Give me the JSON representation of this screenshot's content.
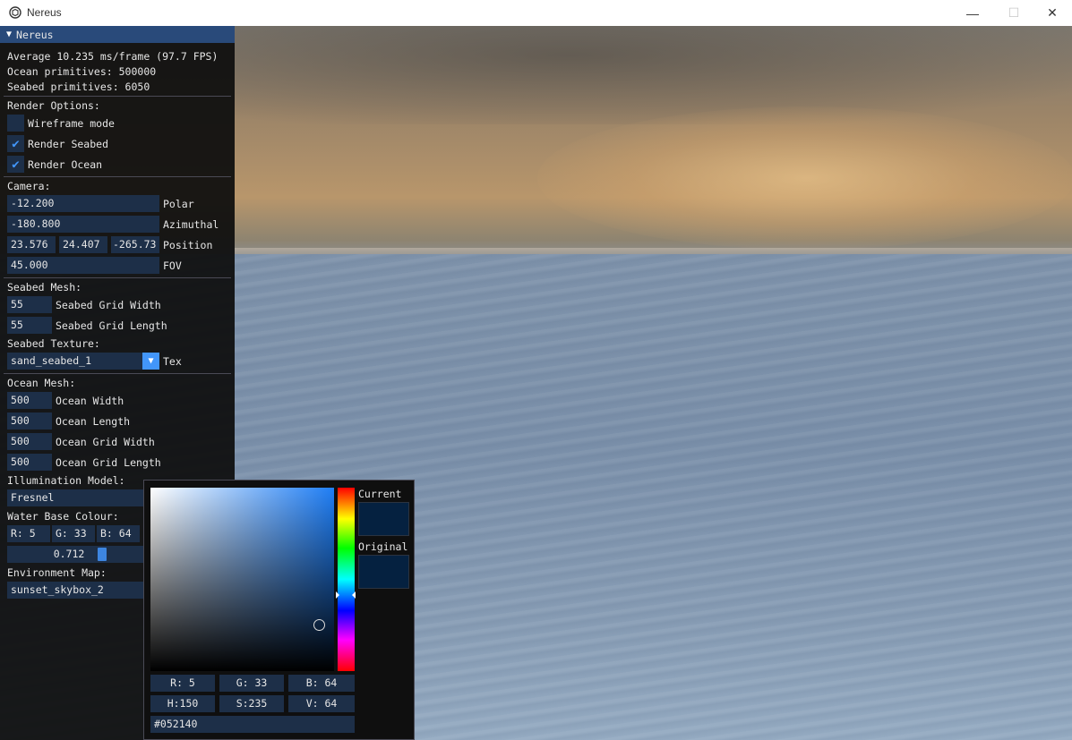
{
  "window": {
    "title": "Nereus",
    "minimize_glyph": "—",
    "maximize_glyph": "☐",
    "close_glyph": "✕"
  },
  "panel": {
    "title": "Nereus",
    "stats": {
      "frame_time": "Average 10.235 ms/frame (97.7 FPS)",
      "ocean_primitives": "Ocean primitives: 500000",
      "seabed_primitives": "Seabed primitives: 6050"
    },
    "render_options": {
      "heading": "Render Options:",
      "wireframe_label": "Wireframe mode",
      "wireframe_checked": false,
      "render_seabed_label": "Render Seabed",
      "render_seabed_checked": true,
      "render_ocean_label": "Render Ocean",
      "render_ocean_checked": true
    },
    "camera": {
      "heading": "Camera:",
      "polar_value": "-12.200",
      "polar_label": "Polar",
      "azimuthal_value": "-180.800",
      "azimuthal_label": "Azimuthal",
      "position_x": "23.576",
      "position_y": "24.407",
      "position_z": "-265.73",
      "position_label": "Position",
      "fov_value": "45.000",
      "fov_label": "FOV"
    },
    "seabed_mesh": {
      "heading": "Seabed Mesh:",
      "grid_width_value": "55",
      "grid_width_label": "Seabed Grid Width",
      "grid_length_value": "55",
      "grid_length_label": "Seabed Grid Length"
    },
    "seabed_texture": {
      "heading": "Seabed Texture:",
      "selected": "sand_seabed_1",
      "label": "Tex"
    },
    "ocean_mesh": {
      "heading": "Ocean Mesh:",
      "width_value": "500",
      "width_label": "Ocean Width",
      "length_value": "500",
      "length_label": "Ocean Length",
      "grid_width_value": "500",
      "grid_width_label": "Ocean Grid Width",
      "grid_length_value": "500",
      "grid_length_label": "Ocean Grid Length"
    },
    "illumination": {
      "heading": "Illumination Model:",
      "selected": "Fresnel"
    },
    "water_colour": {
      "heading": "Water Base Colour:",
      "r": "R:  5",
      "g": "G: 33",
      "b": "B: 64",
      "slider_value": "0.712",
      "slider_fraction": 0.712
    },
    "environment_map": {
      "heading": "Environment Map:",
      "selected": "sunset_skybox_2"
    }
  },
  "color_picker": {
    "current_label": "Current",
    "original_label": "Original",
    "current_color": "#052140",
    "original_color": "#052140",
    "hue_fraction": 0.583,
    "saturation": 0.92,
    "value": 0.25,
    "r": "R:  5",
    "g": "G: 33",
    "b": "B: 64",
    "h": "H:150",
    "s": "S:235",
    "v": "V: 64",
    "hex": "#052140"
  },
  "colors": {
    "accent": "#4296fa",
    "header": "#294a7a",
    "field_bg": "#1d2f48"
  },
  "icons": {
    "check": "✔",
    "collapse": "▼",
    "combo_arrow": "▼"
  }
}
